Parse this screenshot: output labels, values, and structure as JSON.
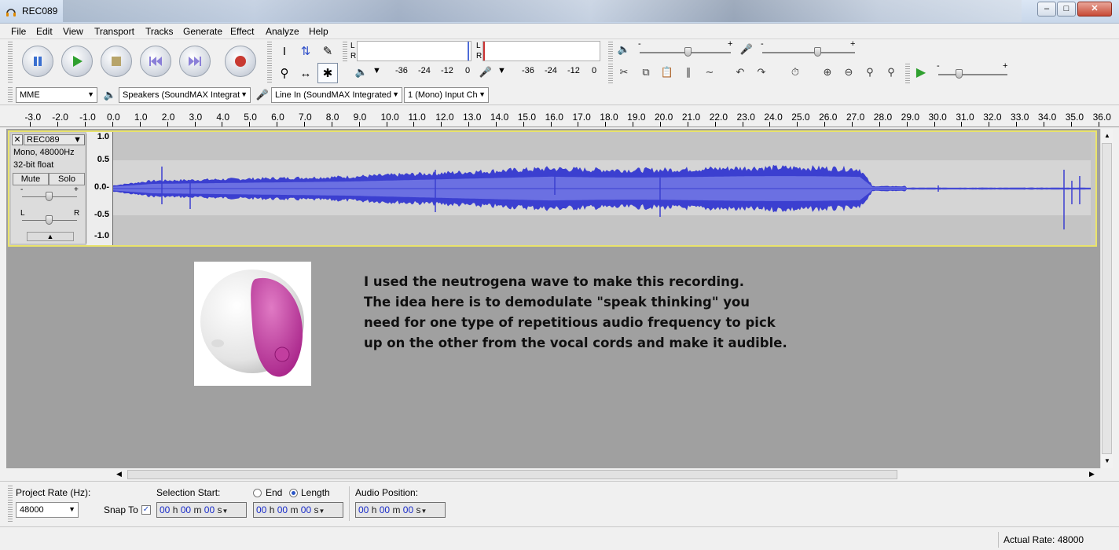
{
  "window": {
    "title": "REC089"
  },
  "menu": [
    "File",
    "Edit",
    "View",
    "Transport",
    "Tracks",
    "Generate",
    "Effect",
    "Analyze",
    "Help"
  ],
  "meters": {
    "playback_channels": [
      "L",
      "R"
    ],
    "record_channels": [
      "L",
      "R"
    ],
    "scale": [
      "-36",
      "-24",
      "-12",
      "0"
    ]
  },
  "mixer": {
    "minus": "-",
    "plus": "+"
  },
  "device_bar": {
    "host": "MME",
    "output": "Speakers (SoundMAX Integrat",
    "input": "Line In (SoundMAX Integrated",
    "channels": "1 (Mono) Input Ch"
  },
  "ruler": {
    "labels": [
      "-3.0",
      "-2.0",
      "-1.0",
      "0.0",
      "1.0",
      "2.0",
      "3.0",
      "4.0",
      "5.0",
      "6.0",
      "7.0",
      "8.0",
      "9.0",
      "10.0",
      "11.0",
      "12.0",
      "13.0",
      "14.0",
      "15.0",
      "16.0",
      "17.0",
      "18.0",
      "19.0",
      "20.0",
      "21.0",
      "22.0",
      "23.0",
      "24.0",
      "25.0",
      "26.0",
      "27.0",
      "28.0",
      "29.0",
      "30.0",
      "31.0",
      "32.0",
      "33.0",
      "34.0",
      "35.0",
      "36.0"
    ]
  },
  "track": {
    "name": "REC089",
    "format": "Mono, 48000Hz",
    "bit_depth": "32-bit float",
    "mute_label": "Mute",
    "solo_label": "Solo",
    "gain_minus": "-",
    "gain_plus": "+",
    "pan_left": "L",
    "pan_right": "R",
    "amplitude_labels": [
      "1.0",
      "0.5",
      "0.0-",
      "-0.5",
      "-1.0"
    ]
  },
  "overlay": {
    "lines": [
      "I used the neutrogena wave to make this recording.",
      "The idea here is to demodulate \"speak thinking\" you",
      "need for one type of repetitious audio frequency to pick",
      "up on the other from the vocal cords and make it audible."
    ]
  },
  "selection_bar": {
    "project_rate_label": "Project Rate (Hz):",
    "project_rate": "48000",
    "snap_to_label": "Snap To",
    "selection_start_label": "Selection Start:",
    "end_label": "End",
    "length_label": "Length",
    "audio_position_label": "Audio Position:",
    "time_units": {
      "h": "h",
      "m": "m",
      "s": "s"
    },
    "start": {
      "h": "00",
      "m": "00",
      "s": "00"
    },
    "length": {
      "h": "00",
      "m": "00",
      "s": "00"
    },
    "position": {
      "h": "00",
      "m": "00",
      "s": "00"
    }
  },
  "status": {
    "actual_rate": "Actual Rate: 48000"
  },
  "colors": {
    "wave": "#3b3fd0",
    "wave_rms": "#6b70e2",
    "track_border": "#e9e36b"
  }
}
